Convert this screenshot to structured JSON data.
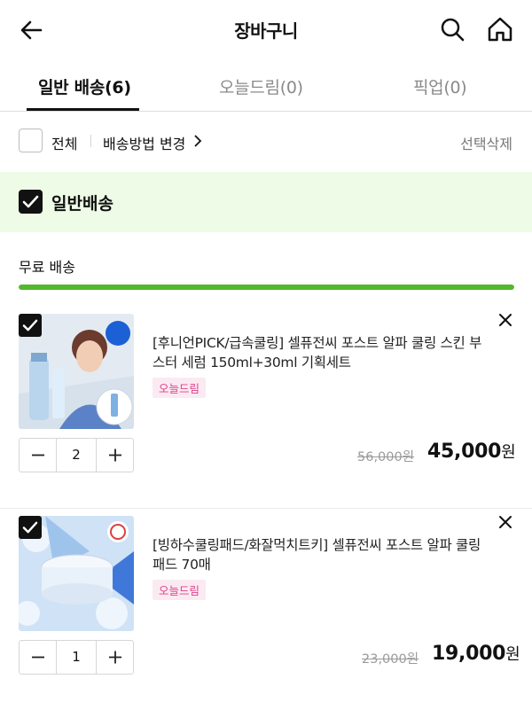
{
  "header": {
    "title": "장바구니",
    "back_icon": "back-arrow-icon",
    "search_icon": "search-icon",
    "home_icon": "home-icon"
  },
  "tabs": [
    {
      "label": "일반 배송(6)",
      "active": true
    },
    {
      "label": "오늘드림(0)",
      "active": false
    },
    {
      "label": "픽업(0)",
      "active": false
    }
  ],
  "select_bar": {
    "all_label": "전체",
    "all_checked": false,
    "method_label": "배송방법 변경",
    "delete_label": "선택삭제"
  },
  "group": {
    "label": "일반배송",
    "checked": true
  },
  "shipping": {
    "label": "무료 배송",
    "progress": 1.0,
    "progress_color": "#52b82c"
  },
  "items": [
    {
      "name": "[후니언PICK/급속쿨링] 셀퓨전씨 포스트 알파 쿨링 스킨 부스터 세럼 150ml+30ml 기획세트",
      "tag": "오늘드림",
      "quantity": "2",
      "original_price": "56,000원",
      "price": "45,000",
      "currency": "원",
      "checked": true
    },
    {
      "name": "[빙하수쿨링패드/화잘먹치트키] 셀퓨전씨 포스트 알파 쿨링 패드 70매",
      "tag": "오늘드림",
      "quantity": "1",
      "original_price": "23,000원",
      "price": "19,000",
      "currency": "원",
      "checked": true
    }
  ]
}
